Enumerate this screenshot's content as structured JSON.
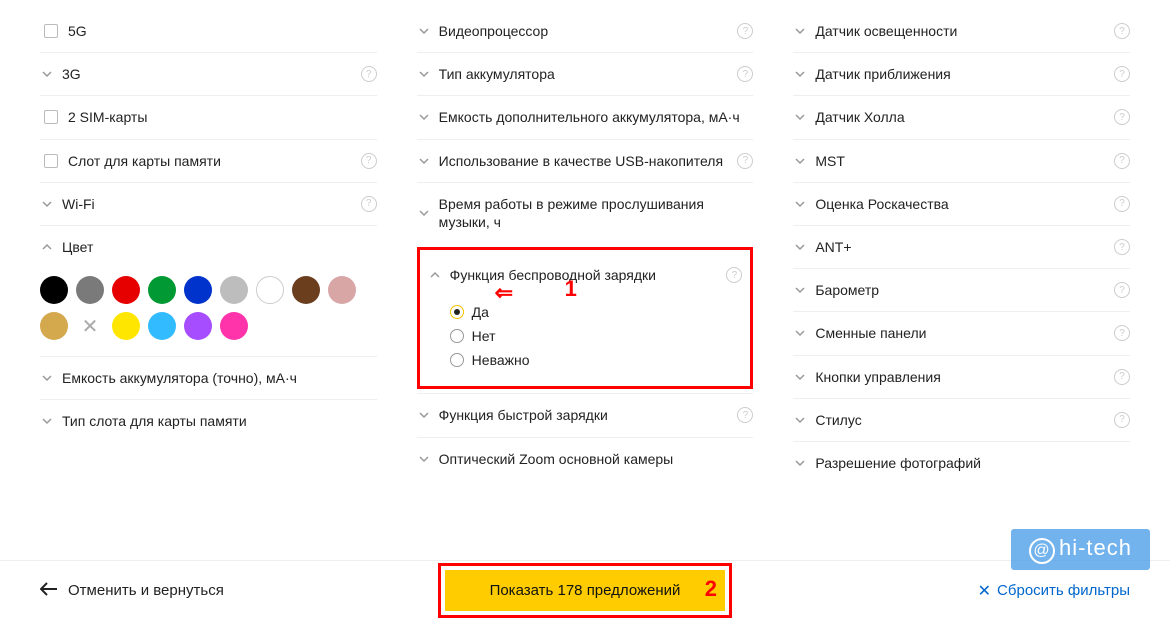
{
  "col1": {
    "items": [
      {
        "kind": "checkbox",
        "label": "5G",
        "help": false
      },
      {
        "kind": "expand",
        "label": "3G",
        "help": true
      },
      {
        "kind": "checkbox",
        "label": "2 SIM-карты",
        "help": false
      },
      {
        "kind": "checkbox",
        "label": "Слот для карты памяти",
        "help": true
      },
      {
        "kind": "expand",
        "label": "Wi-Fi",
        "help": true
      }
    ],
    "color_header": "Цвет",
    "colors": [
      "#000000",
      "#7a7a7a",
      "#e60000",
      "#009933",
      "#0033cc",
      "#bdbdbd",
      "outline",
      "#6b3e1e",
      "#d9a6a6",
      "#d4a84c",
      "x",
      "#ffe600",
      "#33bbff",
      "#a64dff",
      "#ff33aa"
    ],
    "bottom_items": [
      {
        "label": "Емкость аккумулятора (точно), мА·ч",
        "help": false
      },
      {
        "label": "Тип слота для карты памяти",
        "help": false
      }
    ]
  },
  "col2": {
    "items_top": [
      {
        "label": "Видеопроцессор",
        "help": true
      },
      {
        "label": "Тип аккумулятора",
        "help": true
      },
      {
        "label": "Емкость дополнительного аккумулятора, мА·ч",
        "help": false
      },
      {
        "label": "Использование в качестве USB-накопителя",
        "help": true
      },
      {
        "label": "Время работы в режиме прослушивания музыки, ч",
        "help": false
      }
    ],
    "wireless": {
      "label": "Функция беспроводной зарядки",
      "options": [
        "Да",
        "Нет",
        "Неважно"
      ],
      "selected": 0
    },
    "items_bottom": [
      {
        "label": "Функция быстрой зарядки",
        "help": true
      },
      {
        "label": "Оптический Zoom основной камеры",
        "help": false
      }
    ]
  },
  "col3": {
    "items": [
      {
        "label": "Датчик освещенности",
        "help": true
      },
      {
        "label": "Датчик приближения",
        "help": true
      },
      {
        "label": "Датчик Холла",
        "help": true
      },
      {
        "label": "MST",
        "help": true
      },
      {
        "label": "Оценка Роскачества",
        "help": true
      },
      {
        "label": "ANT+",
        "help": true
      },
      {
        "label": "Барометр",
        "help": true
      },
      {
        "label": "Сменные панели",
        "help": true
      },
      {
        "label": "Кнопки управления",
        "help": true
      },
      {
        "label": "Стилус",
        "help": true
      },
      {
        "label": "Разрешение фотографий",
        "help": false
      }
    ]
  },
  "footer": {
    "back": "Отменить и вернуться",
    "show": "Показать 178 предложений",
    "reset": "Сбросить фильтры"
  },
  "annotations": {
    "num1": "1",
    "num2": "2"
  },
  "watermark": "hi-tech"
}
